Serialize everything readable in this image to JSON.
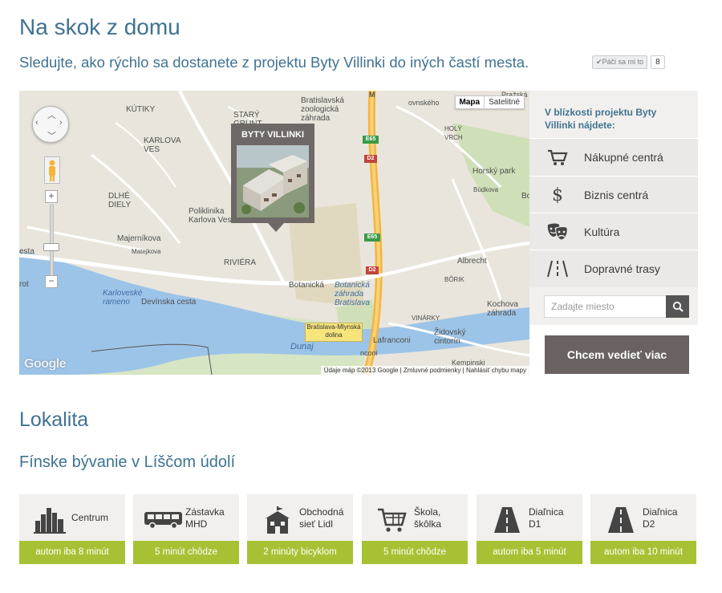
{
  "header": {
    "title": "Na skok z domu",
    "subtitle": "Sledujte, ako rýchlo sa dostanete z projektu Byty Villinki do iných častí mesta.",
    "like_label": "Páči sa mi to",
    "like_count": "8"
  },
  "map": {
    "type_buttons": [
      "Mapa",
      "Satelitné"
    ],
    "popup_title": "BYTY VILLINKI",
    "footer_text": "Údaje máp ©2013 Google  |  Zmluvné podmienky  |  Nahlásiť chybu mapy",
    "logo": "Google",
    "labels": {
      "kutiky": "KÚTIKY",
      "stary_grunt": "STARÝ\nGRUNT",
      "zoo": "Bratislavská\nzoologická\nzáhrada",
      "karlova_ves": "KARLOVA\nVES",
      "dlhe_diely": "DLHÉ\nDIELY",
      "poliklinika": "Poliklinika\nKarlova Ves",
      "majernikova": "Majerníkova",
      "matejkova": "Matejkova",
      "riviera": "RIVIÉRA",
      "botanicka": "Botanická",
      "botanicka_zahrada": "Botanická\nzáhrada\nBratislava",
      "karloveske_rameno": "Karloveské\nrameno",
      "devinska_cesta": "Devínska cesta",
      "dunaj": "Dunaj",
      "sta": "esta",
      "mlynska_dolina": "Bratislava-Mlynská\ndolina",
      "lafranconi": "Lafranconi",
      "zidovsky_cintorin": "Židovský\ncintorín",
      "vinarky": "VINÁRKY",
      "borik": "BÔRIK",
      "albrecht": "Albrecht",
      "kochova_zahrada": "Kochova\nzáhrada",
      "holy_vrch": "HOLÝ\nVRCH",
      "horsky_park": "Horský park",
      "budkova": "Búdkova",
      "ovnskeho": "ovnského",
      "prazska": "Pražská",
      "kempinski": "Kempinski",
      "noconi": "nconi",
      "bo": "Bo",
      "e65_top": "E65",
      "d2_top": "D2",
      "e65_mid": "E65",
      "d2_mid": "D2",
      "d2_top2": "D2",
      "m_top": "M",
      "rot": "rot"
    }
  },
  "nearby": {
    "heading": "V blízkosti projektu Byty Villinki nájdete:",
    "items": [
      {
        "label": "Nákupné centrá",
        "icon": "cart-icon"
      },
      {
        "label": "Biznis centrá",
        "icon": "dollar-icon"
      },
      {
        "label": "Kultúra",
        "icon": "theater-masks-icon"
      },
      {
        "label": "Dopravné trasy",
        "icon": "road-icon"
      }
    ],
    "search_placeholder": "Zadajte miesto",
    "cta": "Chcem vedieť viac"
  },
  "locality": {
    "title": "Lokalita",
    "subtitle": "Fínske bývanie v Líščom údolí",
    "cards": [
      {
        "label": "Centrum",
        "foot": "autom iba 8 minút",
        "icon": "city-skyline-icon"
      },
      {
        "label": "Zástavka\nMHD",
        "foot": "5 minút chôdze",
        "icon": "bus-icon"
      },
      {
        "label": "Obchodná\nsieť Lidl",
        "foot": "2 minúty bicyklom",
        "icon": "store-icon"
      },
      {
        "label": "Škola,\nškôlka",
        "foot": "5 minút chôdze",
        "icon": "cart-icon"
      },
      {
        "label": "Diaľnica\nD1",
        "foot": "autom iba 5 minút",
        "icon": "highway-icon"
      },
      {
        "label": "Diaľnica\nD2",
        "foot": "autom iba 10 minút",
        "icon": "highway-icon"
      }
    ]
  },
  "colors": {
    "heading": "#3f7391",
    "panel_bg": "#f2f0ee",
    "cta_bg": "#6a6260",
    "card_foot": "#a6c234",
    "river": "#7fb3e0"
  }
}
